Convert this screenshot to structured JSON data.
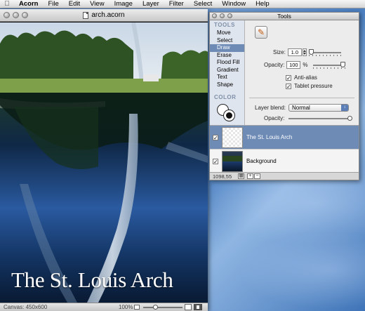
{
  "menubar": {
    "apple_icon": "apple-icon",
    "app_name": "Acorn",
    "items": [
      "File",
      "Edit",
      "View",
      "Image",
      "Layer",
      "Filter",
      "Select",
      "Window",
      "Help"
    ]
  },
  "document": {
    "title": "arch.acorn",
    "caption": "The St. Louis Arch",
    "canvas_size": "Canvas: 450x600",
    "zoom_level": "100%"
  },
  "tools_palette": {
    "title": "Tools",
    "tools_header": "TOOLS",
    "tools": [
      "Move",
      "Select",
      "Draw",
      "Erase",
      "Flood Fill",
      "Gradient",
      "Text",
      "Shape"
    ],
    "selected_tool": "Draw",
    "color_header": "COLOR",
    "size_label": "Size:",
    "size_value": "1.0",
    "opacity_label": "Opacity:",
    "opacity_value": "100",
    "opacity_unit": "%",
    "antialias_label": "Anti-alias",
    "antialias_checked": true,
    "tablet_label": "Tablet pressure",
    "tablet_checked": true,
    "layer_blend_label": "Layer blend:",
    "layer_blend_value": "Normal",
    "layer_opacity_label": "Opacity:",
    "layer_opacity_fraction": 1.0,
    "layers": [
      {
        "name": "The St. Louis Arch",
        "visible": true,
        "selected": true
      },
      {
        "name": "Background",
        "visible": true,
        "selected": false
      }
    ],
    "coordinates": "1098,55",
    "colors": {
      "selection": "#6e8bb6",
      "tool_header": "#7e8fa8"
    }
  }
}
